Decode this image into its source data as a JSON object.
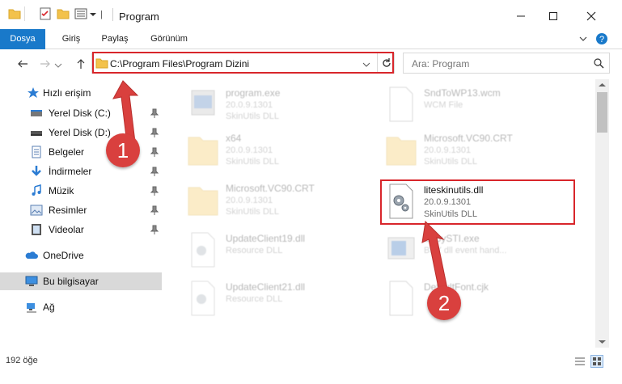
{
  "window": {
    "title": "Program",
    "controls": {
      "minimize": "minimize-icon",
      "maximize": "maximize-icon",
      "close": "close-icon"
    }
  },
  "ribbon": {
    "tabs": [
      {
        "label": "Dosya",
        "active": true
      },
      {
        "label": "Giriş"
      },
      {
        "label": "Paylaş"
      },
      {
        "label": "Görünüm"
      }
    ]
  },
  "address": {
    "path": "C:\\Program Files\\Program Dizini",
    "search_placeholder": "Ara: Program"
  },
  "nav": {
    "quick_access": "Hızlı erişim",
    "items": [
      {
        "label": "Yerel Disk (C:)",
        "icon": "drive-icon",
        "pinned": true
      },
      {
        "label": "Yerel Disk (D:)",
        "icon": "drive-icon",
        "pinned": true
      },
      {
        "label": "Belgeler",
        "icon": "documents-icon",
        "pinned": true
      },
      {
        "label": "İndirmeler",
        "icon": "downloads-icon",
        "pinned": true
      },
      {
        "label": "Müzik",
        "icon": "music-icon",
        "pinned": true
      },
      {
        "label": "Resimler",
        "icon": "pictures-icon",
        "pinned": true
      },
      {
        "label": "Videolar",
        "icon": "videos-icon",
        "pinned": true
      }
    ],
    "onedrive": "OneDrive",
    "this_pc": "Bu bilgisayar",
    "network": "Ağ"
  },
  "files": [
    {
      "name": "program.exe",
      "line1": "20.0.9.1301",
      "line2": "SkinUtils DLL",
      "icon": "exe-icon",
      "faded": true
    },
    {
      "name": "SndToWP13.wcm",
      "line1": "WCM File",
      "line2": "",
      "icon": "file-icon",
      "faded": true
    },
    {
      "name": "x64",
      "line1": "20.0.9.1301",
      "line2": "SkinUtils DLL",
      "icon": "folder-icon",
      "faded": true
    },
    {
      "name": "Microsoft.VC90.CRT",
      "line1": "20.0.9.1301",
      "line2": "SkinUtils DLL",
      "icon": "folder-icon",
      "faded": true
    },
    {
      "name": "Microsoft.VC90.CRT",
      "line1": "20.0.9.1301",
      "line2": "SkinUtils DLL",
      "icon": "folder-icon",
      "faded": true
    },
    {
      "name": "liteskinutils.dll",
      "line1": "20.0.9.1301",
      "line2": "SkinUtils DLL",
      "icon": "dll-gear-icon",
      "faded": false,
      "highlighted": true
    },
    {
      "name": "UpdateClient19.dll",
      "line1": "Resource DLL",
      "line2": "",
      "icon": "dll-gear-icon",
      "faded": true
    },
    {
      "name": "BabySTI.exe",
      "line1": "BBY dll event hand...",
      "line2": "",
      "icon": "exe-icon",
      "faded": true
    },
    {
      "name": "UpdateClient21.dll",
      "line1": "Resource DLL",
      "line2": "",
      "icon": "dll-gear-icon",
      "faded": true
    },
    {
      "name": "DefaultFont.cjk",
      "line1": "",
      "line2": "",
      "icon": "file-icon",
      "faded": true
    }
  ],
  "status": {
    "count": "192 öğe"
  },
  "annotations": {
    "step1": "1",
    "step2": "2"
  },
  "colors": {
    "accent": "#1979ca",
    "highlight_red": "#d8262b",
    "badge_red": "#d9403e"
  }
}
